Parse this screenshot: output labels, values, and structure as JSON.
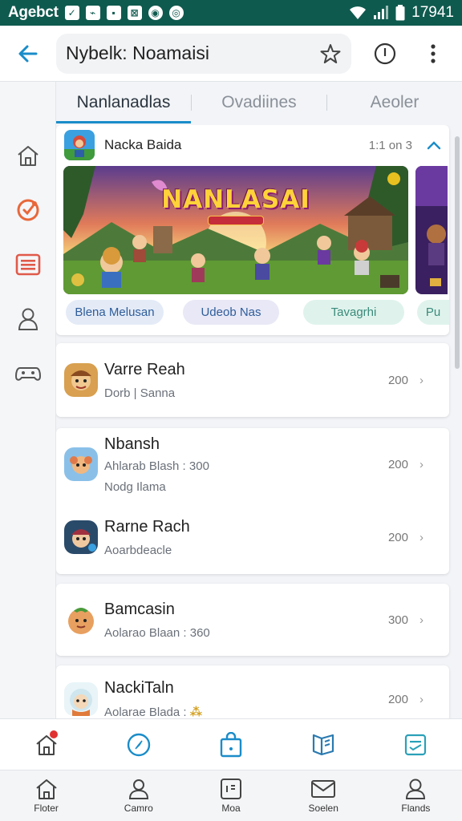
{
  "status_bar": {
    "app_name": "Agebct",
    "time": "17941"
  },
  "app_bar": {
    "search_text": "Nybelk: Noamaisi"
  },
  "tabs": [
    {
      "label": "Nanlanadlas",
      "active": true
    },
    {
      "label": "Ovadiines",
      "active": false
    },
    {
      "label": "Aeoler",
      "active": false
    }
  ],
  "featured": {
    "title": "Nacka Baida",
    "count": "1:1 on 3",
    "banner_title": "NANLASAI",
    "chips": [
      "Blena Melusan",
      "Udeob Nas",
      "Tavagrhi",
      "Pu"
    ]
  },
  "list": [
    {
      "title": "Varre Reah",
      "sub": "Dorb | Sanna",
      "value": "200"
    },
    {
      "title": "Nbansh",
      "sub": "Ahlarab Blash : 300",
      "sub2": "Nodg Ilama",
      "value": "200"
    },
    {
      "title": "Rarne Rach",
      "sub": "Aoarbdeacle",
      "value": "200"
    },
    {
      "title": "Bamcasin",
      "sub": "Aolarao Blaan : 360",
      "value": "300"
    },
    {
      "title": "NackiTaln",
      "sub": "Aolarae Blada :",
      "value": "200"
    }
  ],
  "bottom_nav": [
    {
      "label": "Floter"
    },
    {
      "label": "Camro"
    },
    {
      "label": "Moa"
    },
    {
      "label": "Soelen"
    },
    {
      "label": "Flands"
    }
  ],
  "colors": {
    "status_bar": "#0f5a4f",
    "accent": "#1a8cc9",
    "rail_orange": "#e8683a",
    "rail_red": "#e05a4a"
  }
}
